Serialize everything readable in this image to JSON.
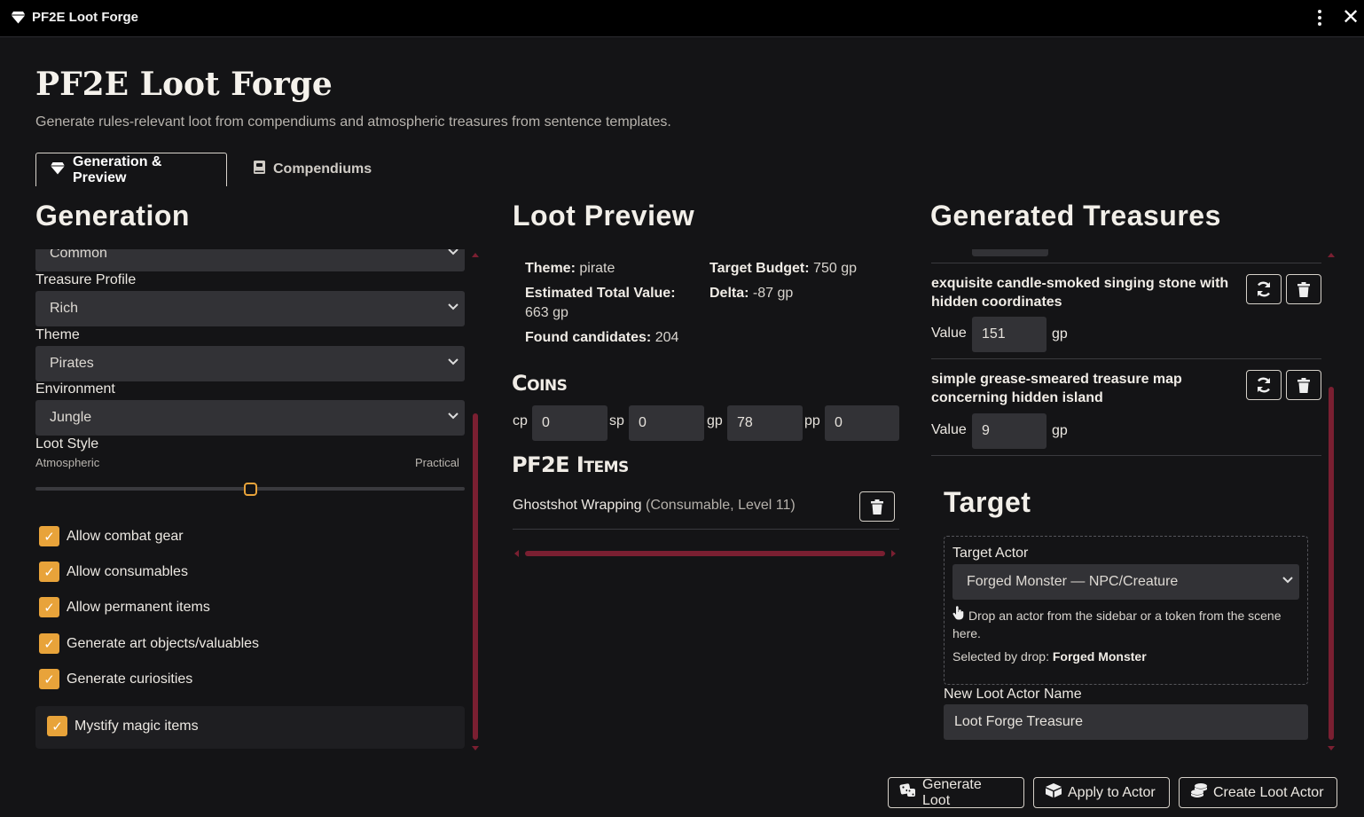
{
  "window": {
    "title": "PF2E Loot Forge"
  },
  "header": {
    "title": "PF2E Loot Forge",
    "subtitle": "Generate rules-relevant loot from compendiums and atmospheric treasures from sentence templates."
  },
  "tabs": [
    {
      "label": "Generation & Preview",
      "active": true
    },
    {
      "label": "Compendiums",
      "active": false
    }
  ],
  "generation": {
    "title": "Generation",
    "rarity_value": "Common",
    "treasure_profile": {
      "label": "Treasure Profile",
      "value": "Rich"
    },
    "theme": {
      "label": "Theme",
      "value": "Pirates"
    },
    "environment": {
      "label": "Environment",
      "value": "Jungle"
    },
    "loot_style": {
      "label": "Loot Style",
      "min_label": "Atmospheric",
      "max_label": "Practical",
      "value_fraction": 0.5
    },
    "checkboxes": [
      {
        "label": "Allow combat gear",
        "checked": true
      },
      {
        "label": "Allow consumables",
        "checked": true
      },
      {
        "label": "Allow permanent items",
        "checked": true
      },
      {
        "label": "Generate art objects/valuables",
        "checked": true
      },
      {
        "label": "Generate curiosities",
        "checked": true
      }
    ],
    "mystify": {
      "label": "Mystify magic items",
      "checked": true
    }
  },
  "preview": {
    "title": "Loot Preview",
    "theme_label": "Theme:",
    "theme_value": "pirate",
    "budget_label": "Target Budget:",
    "budget_value": "750 gp",
    "estimated_label": "Estimated Total Value:",
    "estimated_value": "663 gp",
    "delta_label": "Delta:",
    "delta_value": "-87 gp",
    "candidates_label": "Found candidates:",
    "candidates_value": "204",
    "coins_title": "Coins",
    "coins": [
      {
        "label": "cp",
        "value": "0"
      },
      {
        "label": "sp",
        "value": "0"
      },
      {
        "label": "gp",
        "value": "78"
      },
      {
        "label": "pp",
        "value": "0"
      }
    ],
    "items_title": "PF2E Items",
    "items": [
      {
        "name": "Ghostshot Wrapping",
        "meta": "(Consumable, Level 11)"
      }
    ]
  },
  "treasures": {
    "title": "Generated Treasures",
    "value_label": "Value",
    "unit": "gp",
    "items": [
      {
        "name": "exquisite candle-smoked singing stone with hidden coordinates",
        "value": "151"
      },
      {
        "name": "simple grease-smeared treasure map concerning hidden island",
        "value": "9"
      }
    ]
  },
  "target": {
    "title": "Target",
    "actor_label": "Target Actor",
    "actor_value": "Forged Monster — NPC/Creature",
    "drop_hint": "Drop an actor from the sidebar or a token from the scene here.",
    "selected_label": "Selected by drop:",
    "selected_value": "Forged Monster",
    "new_actor_label": "New Loot Actor Name",
    "new_actor_value": "Loot Forge Treasure"
  },
  "actions": {
    "generate": "Generate Loot",
    "apply": "Apply to Actor",
    "create": "Create Loot Actor"
  },
  "colors": {
    "accent": "#e8a33a",
    "scrollbar": "#7a1f31",
    "field_bg": "#323236"
  }
}
